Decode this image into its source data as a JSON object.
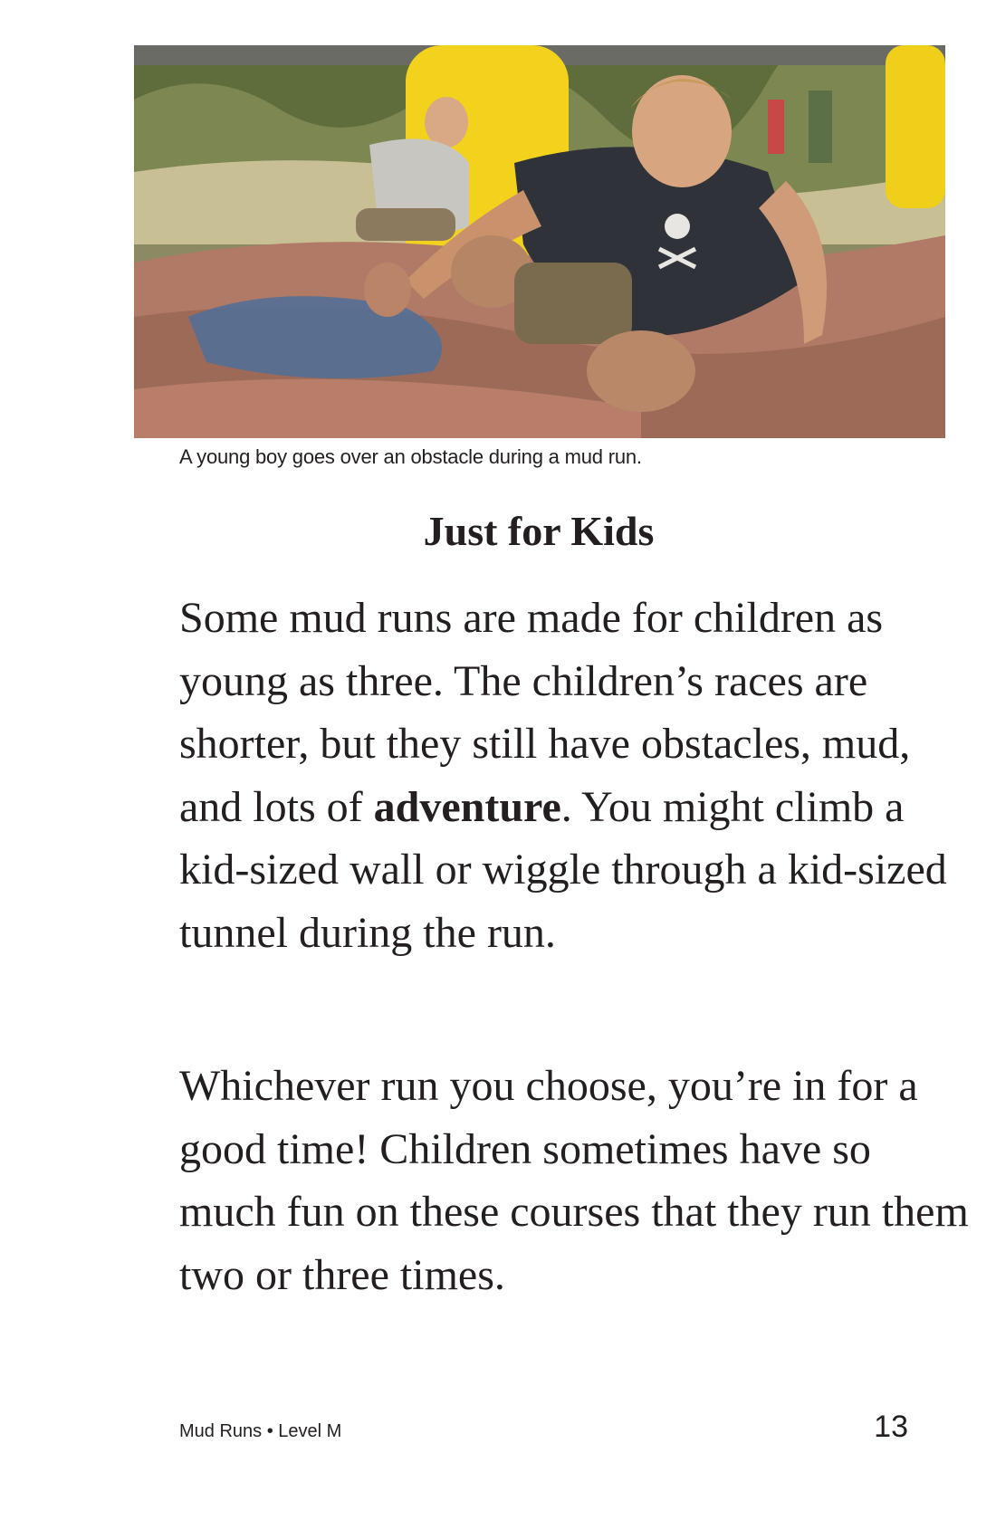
{
  "photo": {
    "alt": "A young boy goes over an obstacle during a mud run.",
    "colors": {
      "sky_trees": "#6f7a4a",
      "yellow_pillar": "#f2d21c",
      "mud_surface": "#a8725f",
      "blue_paint": "#4f6f9a",
      "shirt": "#2f3238",
      "skin": "#d7a680"
    }
  },
  "caption": "A young boy goes over an obstacle during a mud run.",
  "heading": "Just for Kids",
  "paragraphs": {
    "p1_before": "Some mud runs are made for children as young as three. The children’s races are shorter, but they still have obstacles, mud, and lots of ",
    "p1_bold": "adventure",
    "p1_after": ". You might climb a kid-sized wall or wiggle through a kid-sized tunnel during the run.",
    "p2": "Whichever run you choose, you’re in for a good time! Children sometimes have so much fun on these courses that they run them two or three times."
  },
  "footer": {
    "title": "Mud Runs • Level M",
    "page_number": "13"
  }
}
